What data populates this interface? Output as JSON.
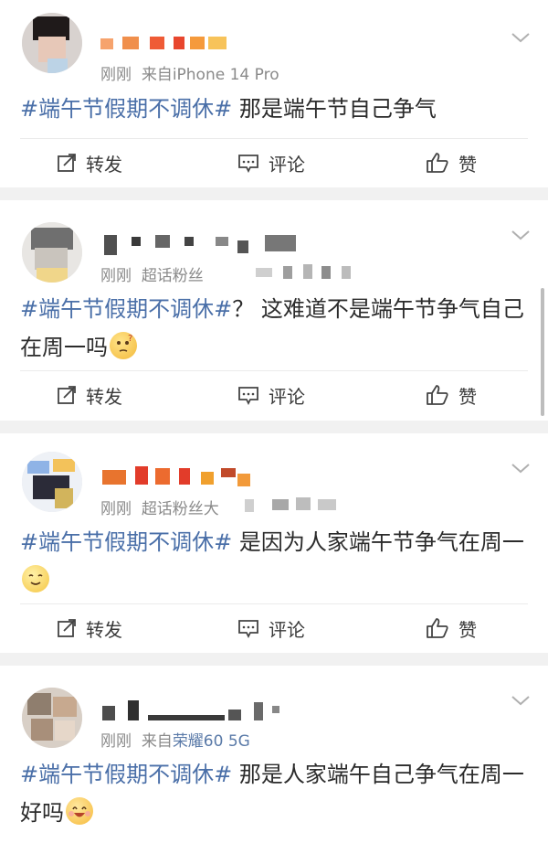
{
  "posts": [
    {
      "time": "刚刚",
      "source_prefix": "来自",
      "source": "iPhone 14 Pro",
      "hashtag": "#端午节假期不调休#",
      "text": " 那是端午节自己争气",
      "emoji": null,
      "actions": {
        "repost": "转发",
        "comment": "评论",
        "like": "赞"
      }
    },
    {
      "time": "刚刚",
      "source_prefix": "",
      "source": "超话粉丝",
      "hashtag": "#端午节假期不调休#",
      "text": "？ 这难道不是端午节争气自己在周一吗",
      "emoji": "thinking-face-icon",
      "actions": {
        "repost": "转发",
        "comment": "评论",
        "like": "赞"
      }
    },
    {
      "time": "刚刚",
      "source_prefix": "",
      "source": "超话粉丝大",
      "hashtag": "#端午节假期不调休#",
      "text": " 是因为人家端午节争气在周一",
      "emoji": "smile-face-icon",
      "actions": {
        "repost": "转发",
        "comment": "评论",
        "like": "赞"
      }
    },
    {
      "time": "刚刚",
      "source_prefix": "来自",
      "source": "荣耀60 5G",
      "hashtag": "#端午节假期不调休#",
      "text": " 那是人家端午自己争气在周一好吗",
      "emoji": "happy-face-icon",
      "actions": {
        "repost": "转发",
        "comment": "评论",
        "like": "赞"
      }
    }
  ],
  "colors": {
    "hashtag": "#4a6fa8",
    "meta": "#8a8a8a",
    "source_highlight": "#5a7aa8",
    "separator": "#f1f1f1"
  }
}
